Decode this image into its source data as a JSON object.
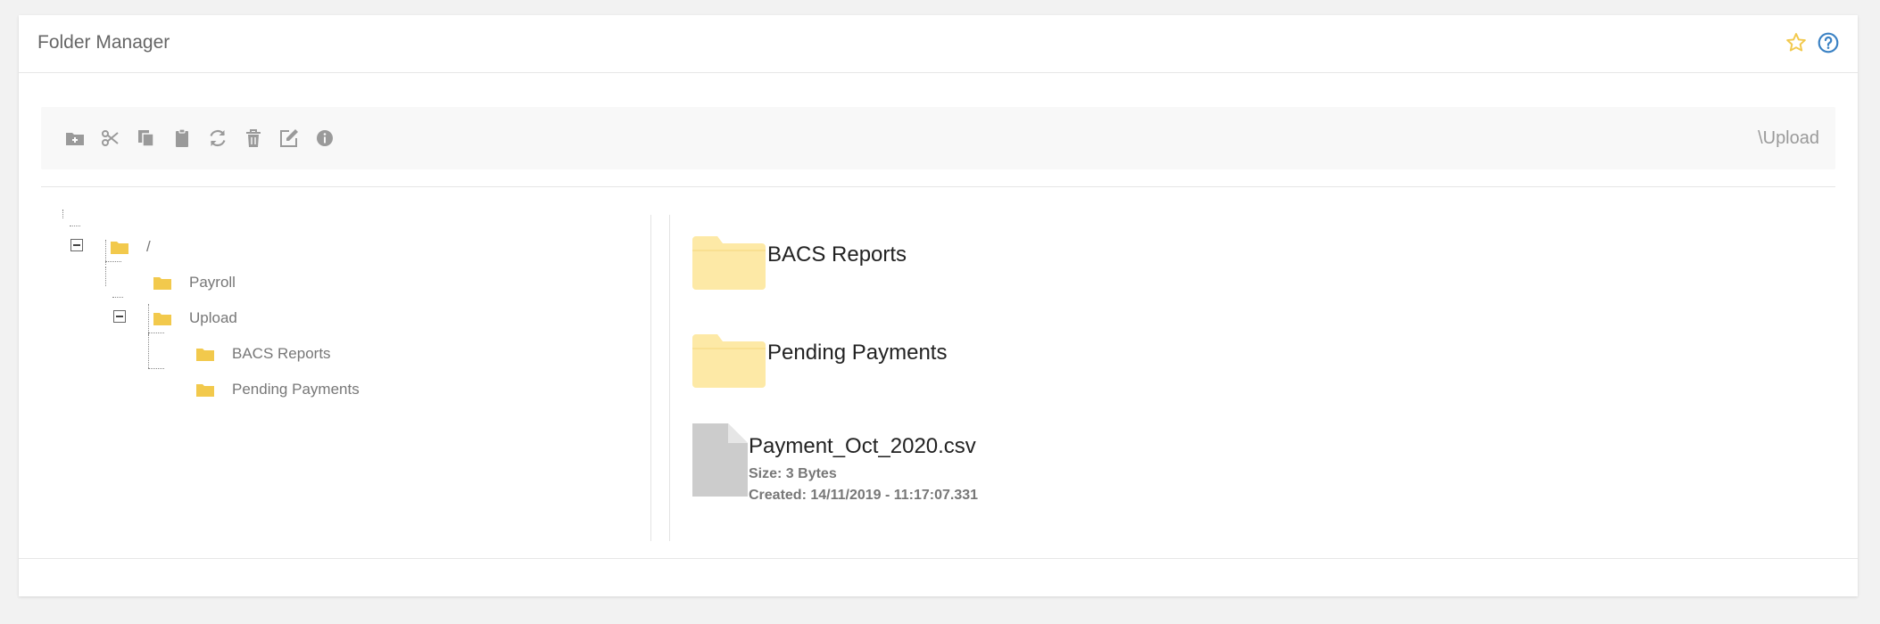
{
  "panel": {
    "title": "Folder Manager"
  },
  "header_icons": [
    "star-outline-icon",
    "help-circle-icon"
  ],
  "toolbar": {
    "buttons": [
      {
        "name": "new-folder-button",
        "icon": "folder-plus-icon"
      },
      {
        "name": "cut-button",
        "icon": "scissors-icon"
      },
      {
        "name": "copy-button",
        "icon": "copy-icon"
      },
      {
        "name": "paste-button",
        "icon": "clipboard-icon"
      },
      {
        "name": "refresh-button",
        "icon": "refresh-icon"
      },
      {
        "name": "delete-button",
        "icon": "trash-icon"
      },
      {
        "name": "rename-button",
        "icon": "edit-icon"
      },
      {
        "name": "info-button",
        "icon": "info-icon"
      }
    ],
    "current_path": "\\Upload"
  },
  "tree": {
    "root": "/",
    "children": [
      {
        "label": "Payroll"
      },
      {
        "label": "Upload",
        "expanded": true,
        "children": [
          {
            "label": "BACS Reports"
          },
          {
            "label": "Pending Payments"
          }
        ]
      }
    ]
  },
  "content": {
    "folders": [
      {
        "name": "BACS Reports"
      },
      {
        "name": "Pending Payments"
      }
    ],
    "files": [
      {
        "name": "Payment_Oct_2020.csv",
        "size": "Size: 3 Bytes",
        "created": "Created: 14/11/2019 - 11:17:07.331"
      }
    ]
  },
  "colors": {
    "folder": "#fde9a6",
    "folder_small": "#f2c94c",
    "file": "#cccccc",
    "icon_gray": "#9a9a9a",
    "accent_blue": "#3b82c4",
    "star": "#f2c94c"
  }
}
